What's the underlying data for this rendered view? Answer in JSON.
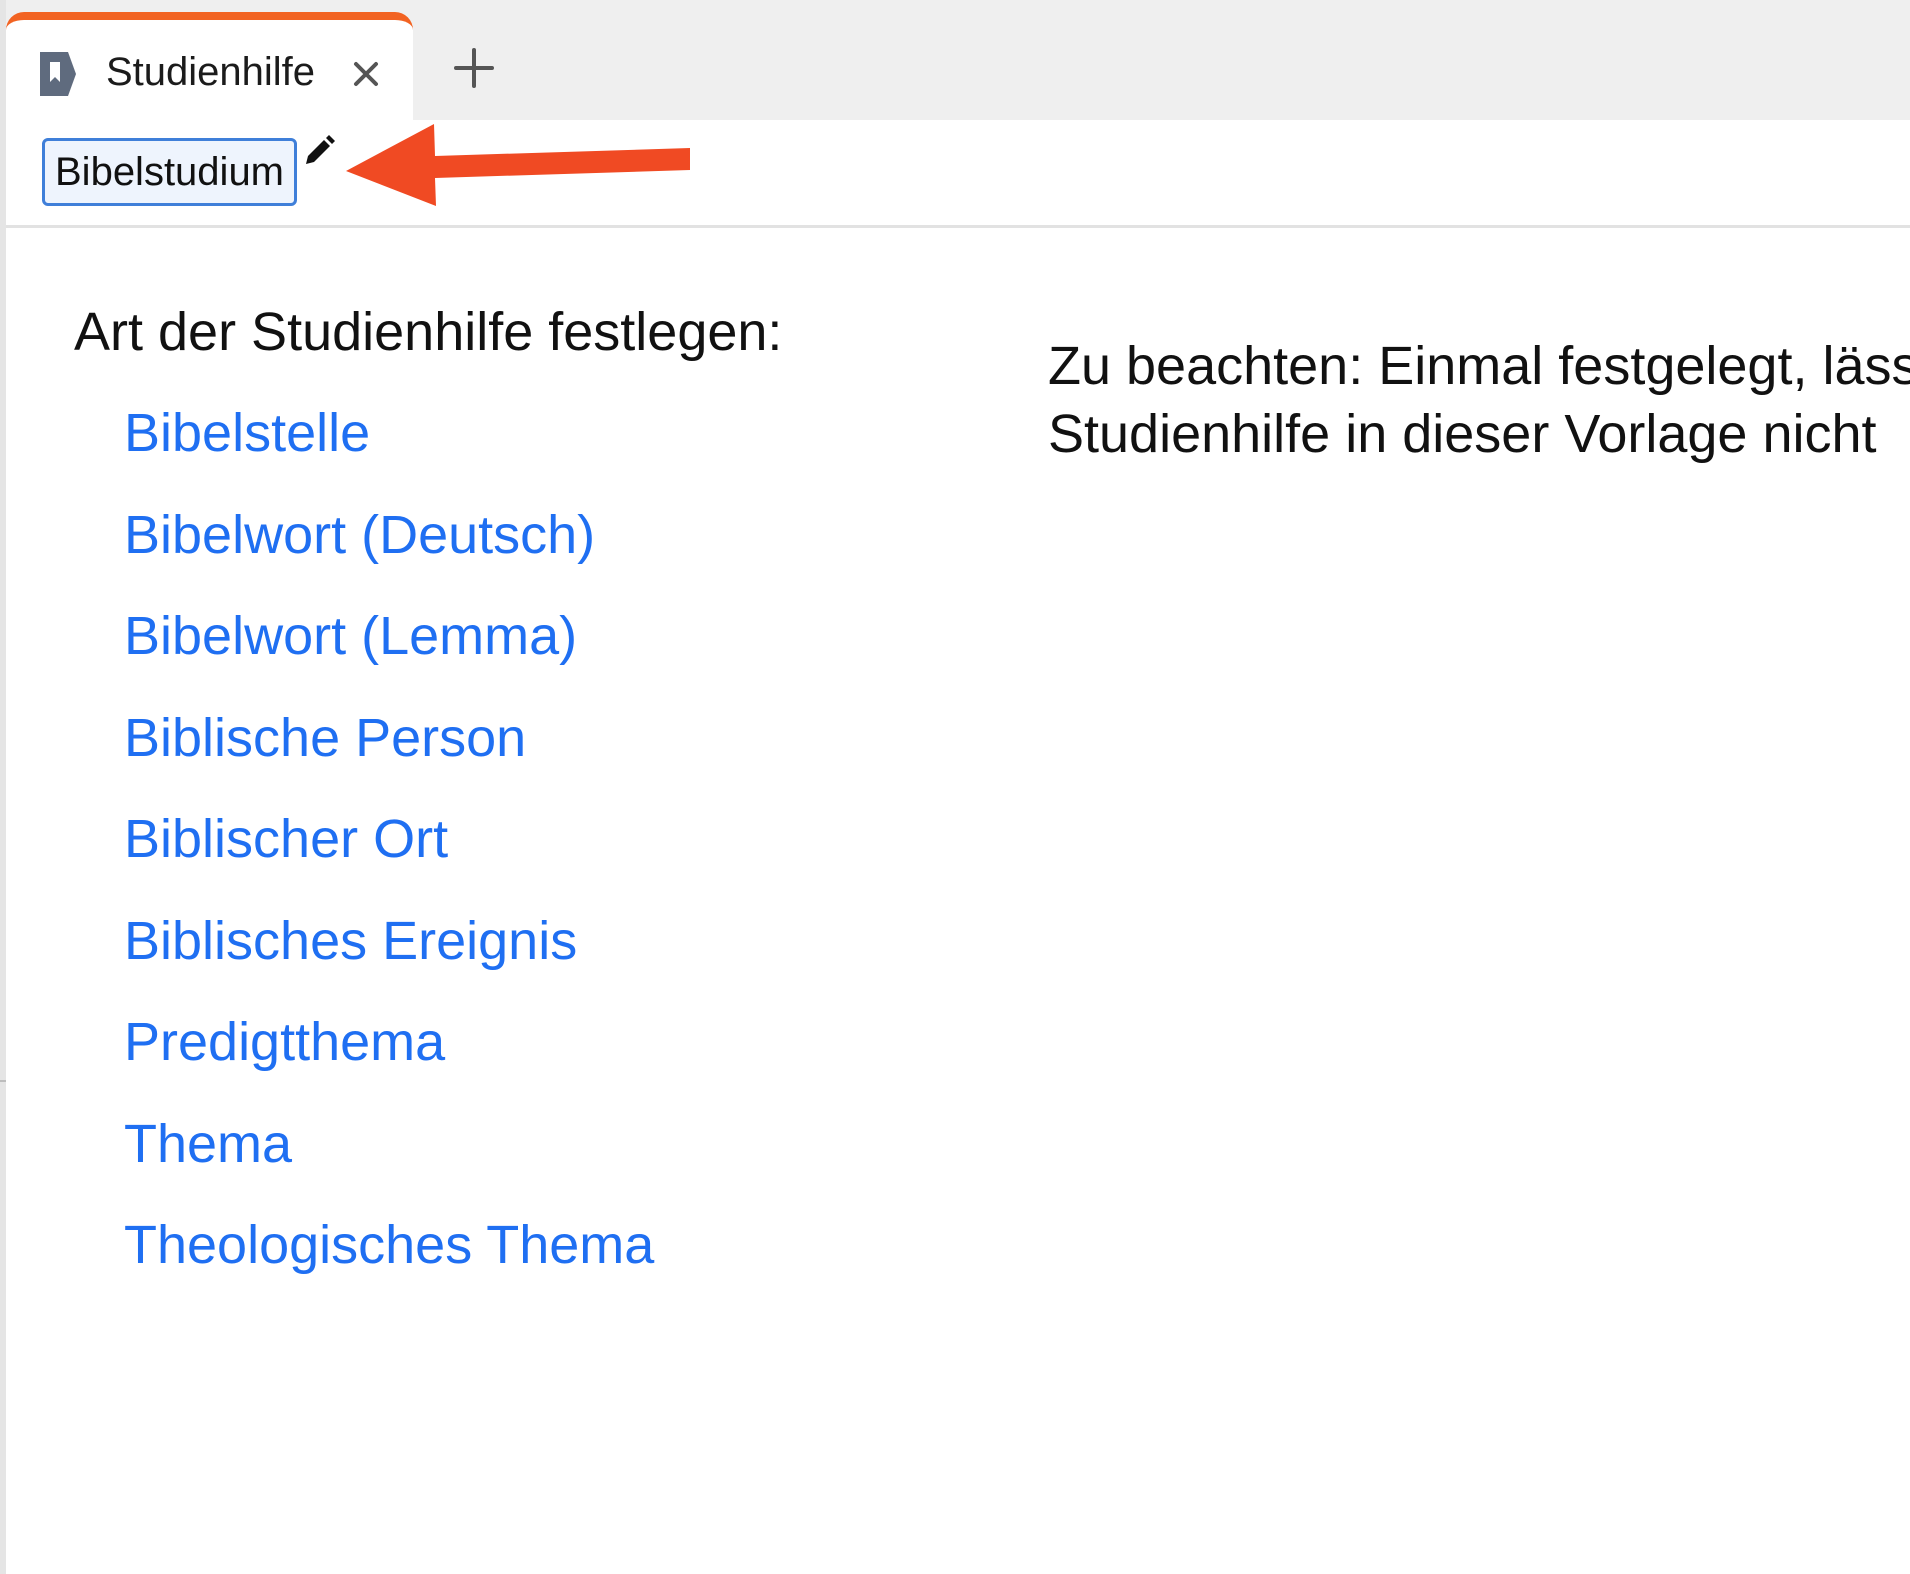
{
  "tab": {
    "label": "Studienhilfe",
    "icon": "guide-document-icon",
    "close_icon": "close-icon",
    "accent_color": "#f26322"
  },
  "new_tab": {
    "icon": "plus-icon"
  },
  "header": {
    "title_value": "Bibelstudium",
    "edit_icon": "pencil-icon",
    "annotation_arrow_color": "#f04a23"
  },
  "main": {
    "heading": "Art der Studienhilfe festlegen:",
    "options": [
      {
        "label": "Bibelstelle"
      },
      {
        "label": "Bibelwort (Deutsch)"
      },
      {
        "label": "Bibelwort (Lemma)"
      },
      {
        "label": "Biblische Person"
      },
      {
        "label": "Biblischer Ort"
      },
      {
        "label": "Biblisches Ereignis"
      },
      {
        "label": "Predigtthema"
      },
      {
        "label": "Thema"
      },
      {
        "label": "Theologisches Thema"
      }
    ],
    "link_color": "#1f6ff2",
    "note_line1": "Zu beachten: Einmal festgelegt, läss",
    "note_line2": "Studienhilfe in dieser Vorlage nicht"
  }
}
